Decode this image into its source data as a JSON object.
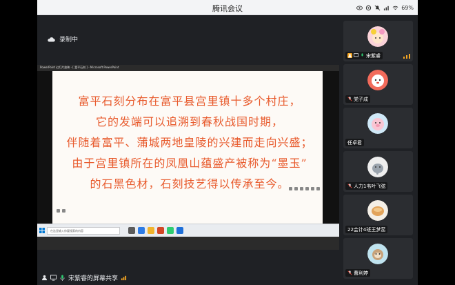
{
  "window": {
    "title": "腾讯会议",
    "battery": "69%"
  },
  "stage": {
    "recording_label": "录制中"
  },
  "ppt": {
    "window_title": "PowerPoint 幻灯片放映 - [ 富平石刻 ] - Microsoft PowerPoint"
  },
  "slide": {
    "lines": [
      "富平石刻分布在富平县宫里镇十多个村庄，",
      "它的发端可以追溯到春秋战国时期，",
      "伴随着富平、蒲城两地皇陵的兴建而走向兴盛；",
      "由于宫里镇所在的凤凰山蕴盛产被称为“墨玉”",
      "的石黑色材，石刻技艺得以传承至今。"
    ],
    "color": "#e85a2c"
  },
  "taskbar": {
    "search_placeholder": "在这里输入你要搜索的内容"
  },
  "bottombar": {
    "share_label": "宋紫睿的屏幕共享"
  },
  "participants": [
    {
      "name": "宋紫睿",
      "avatar": "girl-flower-avatar",
      "speaking": true
    },
    {
      "name": "党子成",
      "avatar": "cartoon-dog-avatar"
    },
    {
      "name": "任卓君",
      "avatar": "pink-pig-avatar"
    },
    {
      "name": "人力1韦叶飞弦",
      "avatar": "elephant-avatar"
    },
    {
      "name": "22会计4班王梦蕊",
      "avatar": "bread-avatar"
    },
    {
      "name": "曹利婷",
      "avatar": "sloth-avatar"
    }
  ],
  "colors": {
    "accent_signal": "#f5a623",
    "mic_green": "#2ecc71"
  }
}
